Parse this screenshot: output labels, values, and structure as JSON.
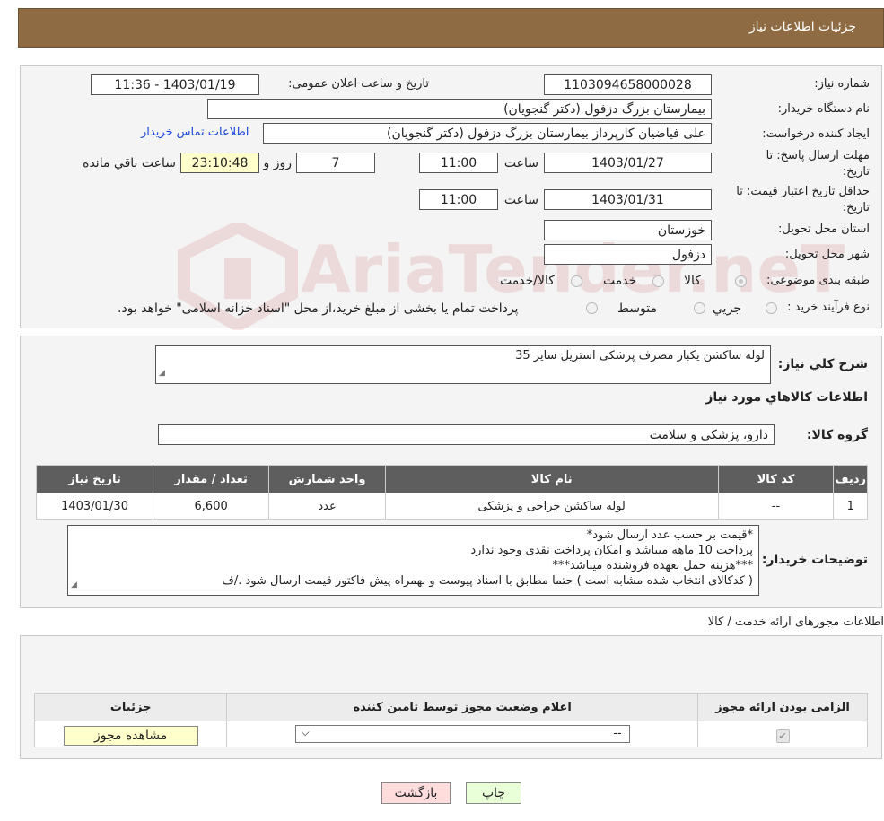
{
  "header": {
    "title": "جزئیات اطلاعات نیاز"
  },
  "form": {
    "need_number_label": "شماره نیاز:",
    "need_number": "1103094658000028",
    "announce_label": "تاریخ و ساعت اعلان عمومی:",
    "announce_value": "1403/01/19 - 11:36",
    "buyer_label": "نام دستگاه خریدار:",
    "buyer_value": "بیمارستان بزرگ دزفول (دکتر گنجویان)",
    "creator_label": "ایجاد کننده درخواست:",
    "creator_value": "علی فیاضیان کارپرداز بیمارستان بزرگ دزفول (دکتر گنجویان)",
    "contact_link": "اطلاعات تماس خریدار",
    "deadline_label_1": "مهلت ارسال پاسخ: تا",
    "deadline_label_2": "تاریخ:",
    "deadline_date": "1403/01/27",
    "time_label": "ساعت",
    "deadline_time": "11:00",
    "days_value": "7",
    "days_label": "روز و",
    "remaining_value": "23:10:48",
    "remaining_label": "ساعت باقي مانده",
    "validity_label_1": "حداقل تاریخ اعتبار قیمت: تا",
    "validity_label_2": "تاریخ:",
    "validity_date": "1403/01/31",
    "validity_time": "11:00",
    "province_label": "استان محل تحویل:",
    "province_value": "خوزستان",
    "city_label": "شهر محل تحویل:",
    "city_value": "دزفول",
    "category_label": "طبقه بندی موضوعی:",
    "category_options": [
      "کالا",
      "خدمت",
      "کالا/خدمت"
    ],
    "process_label": "نوع فرآیند خرید :",
    "process_options": [
      "جزیي",
      "متوسط"
    ],
    "process_note": "پرداخت تمام یا بخشی از مبلغ خرید،از محل \"اسناد خزانه اسلامی\" خواهد بود."
  },
  "description": {
    "label": "شرح کلي نياز:",
    "value": "لوله ساکشن یکبار مصرف پزشکی استریل سایز 35",
    "goods_title": "اطلاعات کالاهاي مورد نياز",
    "group_label": "گروه کالا:",
    "group_value": "دارو، پزشکی و سلامت"
  },
  "goods_table": {
    "headers": [
      "رديف",
      "کد کالا",
      "نام کالا",
      "واحد شمارش",
      "تعداد / مقدار",
      "تاریخ نیاز"
    ],
    "rows": [
      [
        "1",
        "--",
        "لوله ساکشن جراحی و پزشکی",
        "عدد",
        "6,600",
        "1403/01/30"
      ]
    ]
  },
  "buyer_notes": {
    "label": "توضیحات خریدار:",
    "lines": [
      "*قیمت بر حسب عدد ارسال شود*",
      "پرداخت 10 ماهه میباشد و امکان پرداخت نقدی وجود ندارد",
      "***هزینه حمل بعهده فروشنده میباشد***",
      "( کدکالای انتخاب شده مشابه است ) حتما مطابق با اسناد پیوست و بهمراه پیش فاکتور قیمت ارسال شود ./ف"
    ]
  },
  "permits": {
    "title": "اطلاعات مجوزهای ارائه خدمت / کالا",
    "headers": [
      "الزامی بودن ارائه مجوز",
      "اعلام وضعیت مجوز توسط تامین کننده",
      "جزئیات"
    ],
    "select_value": "--",
    "view_button": "مشاهده مجوز"
  },
  "actions": {
    "print": "چاپ",
    "back": "بازگشت"
  },
  "watermark": "AriaTender.neT",
  "colors": {
    "header": "#8e6b42",
    "table_header": "#5e5e5e",
    "link": "#1a47d6",
    "back_button": "#ffdddd",
    "print_button": "#e8ffd8"
  }
}
